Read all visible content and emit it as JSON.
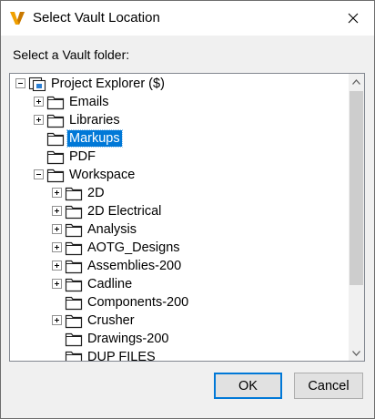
{
  "window": {
    "title": "Select Vault Location",
    "app_icon": "autodesk-vault-icon",
    "close_icon": "close-icon"
  },
  "prompt": "Select a Vault folder:",
  "tree": {
    "root": {
      "label": "Project Explorer ($)",
      "state": "expanded"
    },
    "items": [
      {
        "label": "Emails",
        "state": "collapsed"
      },
      {
        "label": "Libraries",
        "state": "collapsed"
      },
      {
        "label": "Markups",
        "state": "leaf",
        "selected": true
      },
      {
        "label": "PDF",
        "state": "leaf"
      },
      {
        "label": "Workspace",
        "state": "expanded"
      }
    ],
    "workspace_children": [
      {
        "label": "2D",
        "state": "collapsed"
      },
      {
        "label": "2D Electrical",
        "state": "collapsed"
      },
      {
        "label": "Analysis",
        "state": "collapsed"
      },
      {
        "label": "AOTG_Designs",
        "state": "collapsed"
      },
      {
        "label": "Assemblies-200",
        "state": "collapsed"
      },
      {
        "label": "Cadline",
        "state": "collapsed"
      },
      {
        "label": "Components-200",
        "state": "leaf"
      },
      {
        "label": "Crusher",
        "state": "collapsed"
      },
      {
        "label": "Drawings-200",
        "state": "leaf"
      },
      {
        "label": "DUP FILES",
        "state": "leaf"
      }
    ]
  },
  "buttons": {
    "ok": "OK",
    "cancel": "Cancel"
  },
  "colors": {
    "selection": "#0078d7",
    "folder_outline": "#1e1e1e"
  }
}
